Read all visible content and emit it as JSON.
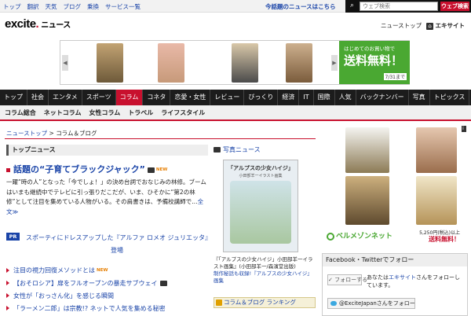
{
  "topbar": {
    "links": [
      "トップ",
      "翻訳",
      "天気",
      "ブログ",
      "乗換",
      "サービス一覧"
    ],
    "today_link": "今話題のニュースはこちら",
    "search_placeholder": "ウェブ検索",
    "search_button": "ウェブ検索"
  },
  "logo": {
    "brand": "excite",
    "section": "ニュース"
  },
  "header_right": {
    "news_top": "ニューストップ",
    "excite": "エキサイト"
  },
  "banner": {
    "line1": "はじめてのお買い物で",
    "line2": "送料無料！",
    "line3": "7/31まで"
  },
  "nav": {
    "items": [
      "トップ",
      "社会",
      "エンタメ",
      "スポーツ",
      "コラム",
      "コネタ",
      "恋愛・女性",
      "レビュー",
      "びっくり",
      "経済",
      "IT",
      "国際",
      "人気",
      "バックナンバー",
      "写真",
      "トピックス"
    ],
    "active": "コラム"
  },
  "subnav": {
    "items": [
      "コラム総合",
      "ネットコラム",
      "女性コラム",
      "トラベル",
      "ライフスタイル"
    ]
  },
  "breadcrumb": {
    "home": "ニューストップ",
    "sep": " > ",
    "current": "コラム＆ブログ"
  },
  "top_news": {
    "heading": "トップニュース",
    "headline": "話題の“子育てブラックジャック”",
    "new_badge": "NEW",
    "lead": "一躍“時の人”となった「今でしょ！」の決め台詞でおなじみの林修。ブームはいまも継続中でテレビに引っ張りだこだが、いま、ひそかに“第2の林修”として注目を集めている人物がいる。その肩書きは、予備校講師で…",
    "more": "全文≫"
  },
  "pr": {
    "badge": "PR",
    "text": "スポーティにドレスアップした『アルファ ロメオ ジュリエッタ』登場"
  },
  "news_list": [
    "注目の視力回復メソッドとは",
    "【おそロシア】扉をフルオープンの暴走サブウェイ",
    "女性が「おっさん化」を感じる瞬間",
    "「ラーメン二郎」は宗教!? ネットで人気を集める秘密"
  ],
  "photo_news": {
    "heading": "写真ニュース",
    "book_title": "「アルプスの少女ハイジ」",
    "book_sub": "小田部羊一イラスト画集",
    "caption": "『「アルプスの少女ハイジ」小田部羊一イラスト画集』(小田部羊一/森濱堂出版)",
    "caption_link": "制作秘話も収録!『アルプスの少女ハイジ』画集"
  },
  "column_ranking": {
    "label": "コラム＆ブログ ランキング"
  },
  "ad": {
    "brand": "ベルメゾンネット",
    "price1": "5,250円(税込)以上",
    "price2": "送料無料！"
  },
  "social": {
    "heading": "Facebook・Twitterでフォロー",
    "follow_button": "フォローする",
    "text_prefix": "あなたは",
    "text_link": "エキサイト",
    "text_suffix": "さんをフォローしています。",
    "twitter_button": "@ExciteJapanさんをフォロー"
  },
  "colors": {
    "accent": "#c8102e",
    "link": "#1a44a8",
    "banner_green": "#4aa832"
  }
}
